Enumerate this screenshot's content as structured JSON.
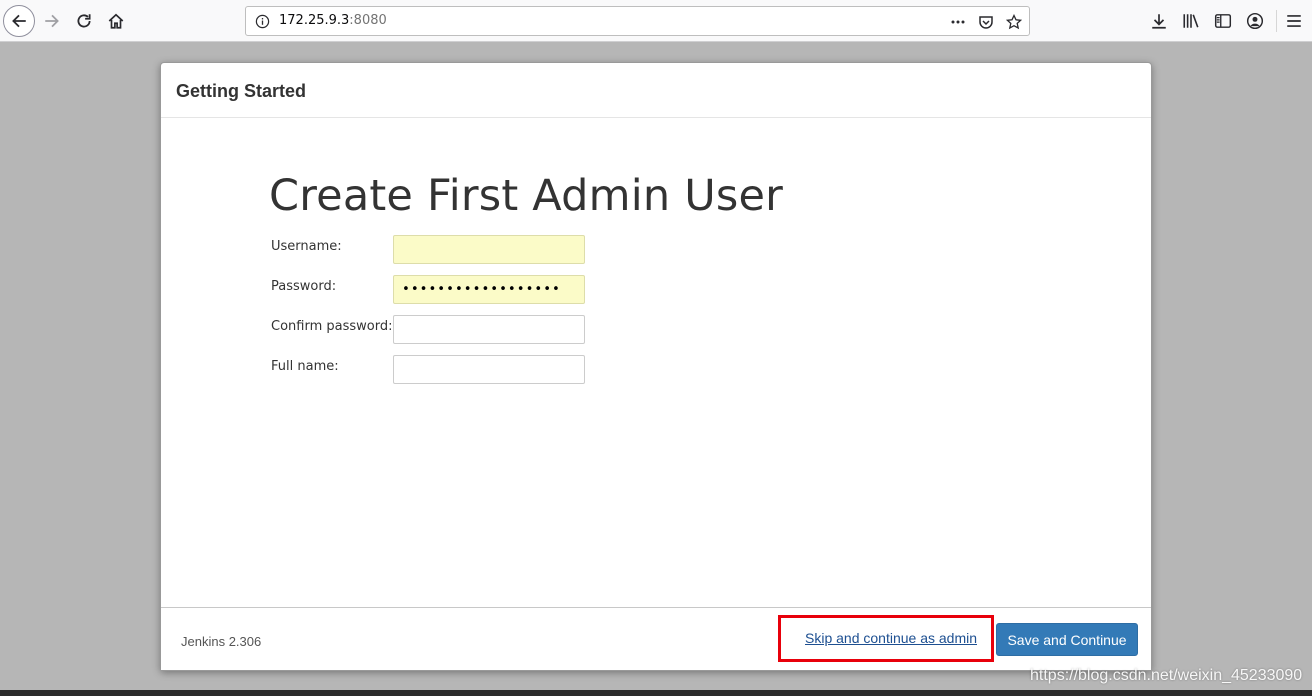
{
  "browser": {
    "url_host": "172.25.9.3",
    "url_port": ":8080",
    "icons": [
      "back-icon",
      "forward-icon",
      "reload-icon",
      "home-icon",
      "info-icon",
      "page-actions-icon",
      "pocket-icon",
      "bookmark-star-icon",
      "download-icon",
      "library-icon",
      "sidebar-icon",
      "account-icon",
      "menu-icon"
    ]
  },
  "dialog": {
    "title": "Getting Started",
    "heading": "Create First Admin User",
    "fields": [
      {
        "label": "Username:",
        "value": ""
      },
      {
        "label": "Password:",
        "value": "••••••••••••••••••"
      },
      {
        "label": "Confirm password:",
        "value": ""
      },
      {
        "label": "Full name:",
        "value": ""
      }
    ]
  },
  "footer": {
    "version": "Jenkins 2.306",
    "skip_label": "Skip and continue as admin",
    "save_label": "Save and Continue",
    "highlight_color": "#e8000b",
    "button_color": "#337ab7"
  },
  "watermark": "https://blog.csdn.net/weixin_45233090"
}
